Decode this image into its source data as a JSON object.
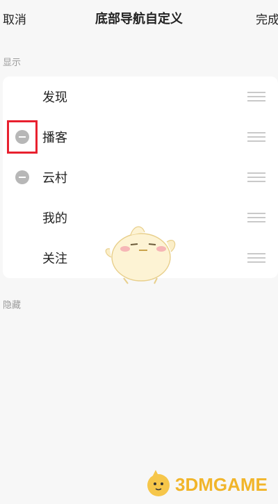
{
  "header": {
    "cancel_label": "取消",
    "title": "底部导航自定义",
    "done_label": "完成"
  },
  "sections": {
    "shown_label": "显示",
    "hidden_label": "隐藏"
  },
  "shown_items": [
    {
      "label": "发现",
      "removable": false
    },
    {
      "label": "播客",
      "removable": true
    },
    {
      "label": "云村",
      "removable": true
    },
    {
      "label": "我的",
      "removable": false
    },
    {
      "label": "关注",
      "removable": false
    }
  ],
  "watermark": {
    "text": "3DMGAME"
  },
  "colors": {
    "highlight_border": "#e8202e",
    "watermark": "#f1b52a",
    "minus_icon": "#b7b7b7"
  }
}
